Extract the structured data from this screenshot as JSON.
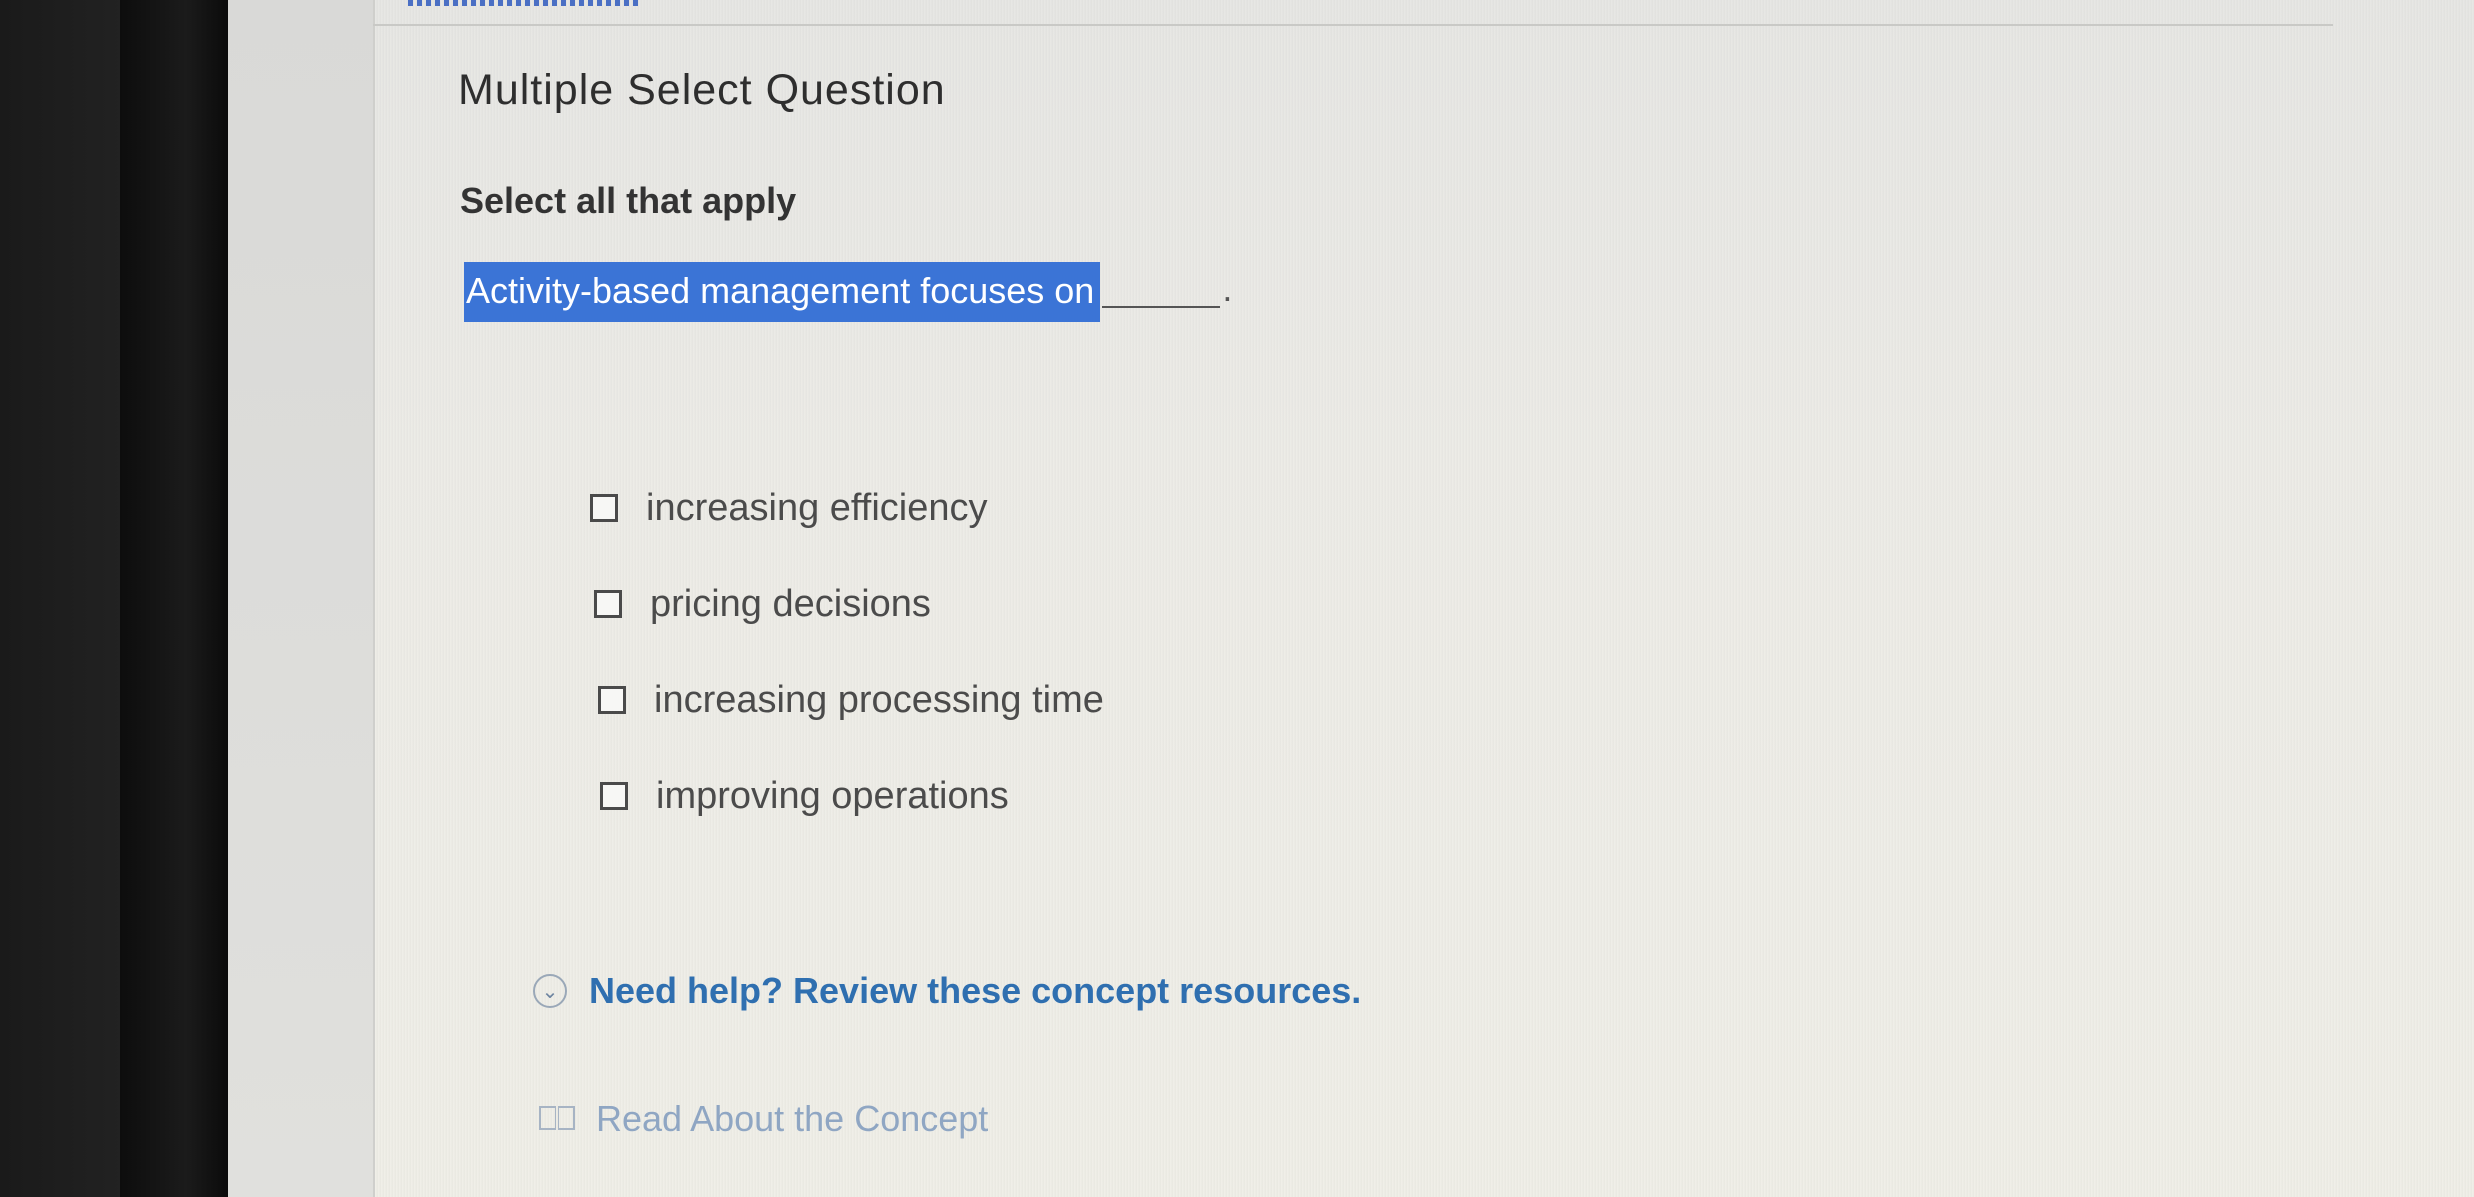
{
  "question": {
    "type_label": "Multiple Select Question",
    "instructions": "Select all that apply",
    "prompt": "Activity-based management focuses on",
    "prompt_end": "."
  },
  "options": [
    {
      "label": "increasing efficiency",
      "checked": false
    },
    {
      "label": "pricing decisions",
      "checked": false
    },
    {
      "label": "increasing processing time",
      "checked": false
    },
    {
      "label": "improving operations",
      "checked": false
    }
  ],
  "help": {
    "toggle_label": "Need help? Review these concept resources.",
    "toggle_icon": "chevron-down-icon"
  },
  "resources": {
    "read_label": "Read About the Concept",
    "read_icon": "book-icon"
  },
  "colors": {
    "highlight": "#3b74d6",
    "link": "#2f6fb0",
    "muted_link": "#8fa6c3"
  }
}
